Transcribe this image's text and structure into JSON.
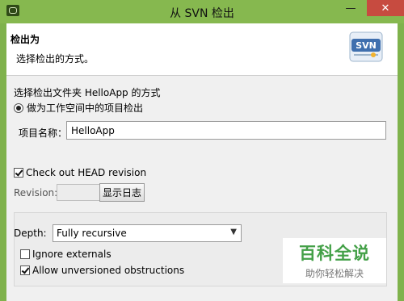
{
  "window": {
    "title": "从 SVN 检出",
    "minimize_glyph": "—",
    "close_glyph": "✕",
    "app_icon": "app-window-icon"
  },
  "header": {
    "title": "检出为",
    "description": "选择检出的方式。",
    "logo_text": "SVN"
  },
  "checkout": {
    "section_label": "选择检出文件夹 HelloApp 的方式",
    "option_label": "做为工作空间中的项目检出",
    "option_selected": true,
    "project_name_label": "项目名称：",
    "project_name_value": "HelloApp"
  },
  "revision": {
    "head_label": "Check out HEAD revision",
    "head_checked": true,
    "revision_label": "Revision:",
    "revision_value": "",
    "show_log_button": "显示日志"
  },
  "options": {
    "depth_label": "Depth:",
    "depth_value": "Fully recursive",
    "ignore_externals_label": "Ignore externals",
    "ignore_externals_checked": false,
    "allow_unversioned_label": "Allow unversioned obstructions",
    "allow_unversioned_checked": true
  },
  "watermark": {
    "main": "百科全说",
    "sub": "助你轻松解决"
  },
  "colors": {
    "titlebar": "#86b84f",
    "close_button": "#c74b40",
    "watermark_green": "#43a047"
  }
}
